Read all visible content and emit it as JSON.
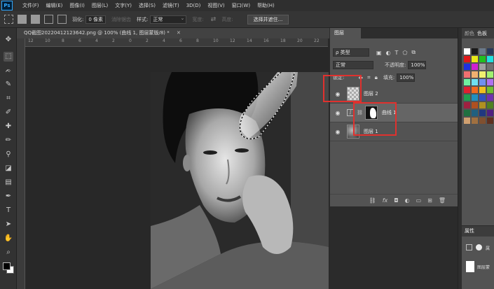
{
  "app": {
    "logo": "Ps"
  },
  "menu": [
    "文件(F)",
    "编辑(E)",
    "图像(I)",
    "图层(L)",
    "文字(Y)",
    "选择(S)",
    "滤镜(T)",
    "3D(D)",
    "视图(V)",
    "窗口(W)",
    "帮助(H)"
  ],
  "options": {
    "feather_label": "羽化:",
    "feather_value": "0 像素",
    "antialias_label": "消除锯齿",
    "style_label": "样式:",
    "style_value": "正常",
    "width_label": "宽度:",
    "height_label": "高度:",
    "select_subject_button": "选择并遮住..."
  },
  "document": {
    "tab_title": "QQ截图20220412123642.png @ 100% (曲线 1, 图层蒙版/8) *",
    "ruler_numbers": [
      "12",
      "10",
      "8",
      "6",
      "4",
      "2",
      "0",
      "2",
      "4",
      "6",
      "8",
      "10",
      "12",
      "14",
      "16",
      "18",
      "20",
      "22"
    ]
  },
  "layers": {
    "tab": "图层",
    "filter_kind": "ρ 类型",
    "blend_mode": "正常",
    "opacity_label": "不透明度:",
    "opacity_value": "100%",
    "lock_label": "锁定:",
    "fill_label": "填充:",
    "fill_value": "100%",
    "rows": [
      {
        "name": "图层 2",
        "visible": true,
        "selected": false,
        "thumb": "checker"
      },
      {
        "name": "曲线 1",
        "visible": true,
        "selected": true,
        "thumb": "mask"
      },
      {
        "name": "图层 1",
        "visible": true,
        "selected": false,
        "thumb": "photo"
      }
    ],
    "bottom_icons": [
      "link-icon",
      "fx-icon",
      "mask-icon",
      "adjustment-icon",
      "group-icon",
      "new-layer-icon",
      "trash-icon"
    ]
  },
  "swatches": {
    "tabs": [
      "颜色",
      "色板"
    ],
    "colors": [
      "#ffffff",
      "#1a1a1a",
      "#6a7a8a",
      "#2a3a5a",
      "#e01818",
      "#e8e818",
      "#20c020",
      "#20e0e0",
      "#2030e0",
      "#d020d0",
      "#a0a0a0",
      "#707070",
      "#f07070",
      "#f0b070",
      "#f0f070",
      "#a0f070",
      "#70f0a0",
      "#70e0f0",
      "#7090f0",
      "#b070f0",
      "#e02030",
      "#f06a20",
      "#f0c020",
      "#70c030",
      "#20a050",
      "#2090c0",
      "#3050c0",
      "#7030b0",
      "#a02040",
      "#b05020",
      "#b09020",
      "#508020",
      "#207040",
      "#206080",
      "#203880",
      "#502080",
      "#d0a070",
      "#a07040",
      "#805030",
      "#603020"
    ]
  },
  "properties": {
    "tab": "属性",
    "row1": "属",
    "row2": "图层蒙"
  }
}
